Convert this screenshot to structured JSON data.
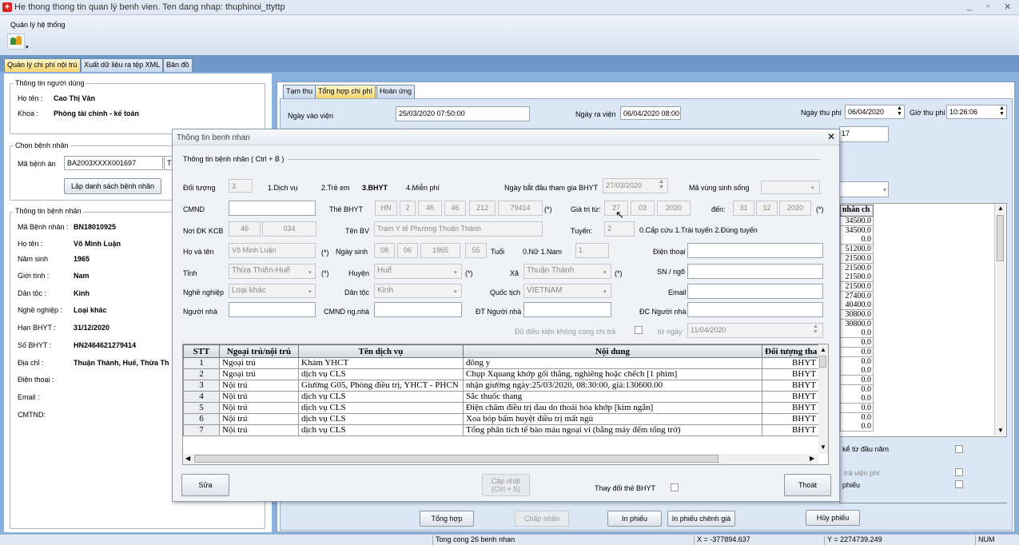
{
  "window": {
    "title": "He thong thong tin quan lý benh vien. Ten dang nhap: thuphinoi_ttyttp",
    "controls": [
      "_",
      "▫",
      "✕"
    ]
  },
  "menu": {
    "system": "Quản lý hệ thống"
  },
  "main_tabs": [
    {
      "label": "Quản lý chi phí nội trú",
      "active": true
    },
    {
      "label": "Xuất dữ liệu ra tệp XML",
      "active": false
    },
    {
      "label": "Bản đồ",
      "active": false
    }
  ],
  "user_info": {
    "group": "Thông tin người dùng",
    "name_label": "Họ tên :",
    "name": "Cao Thị Vân",
    "dept_label": "Khoa :",
    "dept": "Phòng tài chính - kế toán"
  },
  "select_patient": {
    "group": "Chọn bệnh nhân",
    "record_label": "Mã bệnh án",
    "record_value": "BA2003XXXX001697",
    "record_tail": "T",
    "list_button": "Lập danh sách bệnh nhân"
  },
  "patient_panel": {
    "group": "Thông tin bệnh nhân",
    "rows": [
      {
        "label": "Mã Bệnh nhân :",
        "value": "BN18010925"
      },
      {
        "label": "Họ tên :",
        "value": "Võ Minh Luận"
      },
      {
        "label": "Năm sinh",
        "value": "1965"
      },
      {
        "label": "Giới tính :",
        "value": "Nam"
      },
      {
        "label": "Dân tộc :",
        "value": "Kinh"
      },
      {
        "label": "Nghề nghiệp :",
        "value": "Loại khác"
      },
      {
        "label": "Hạn BHYT :",
        "value": "31/12/2020"
      },
      {
        "label": "Số BHYT :",
        "value": "HN2464621279414"
      },
      {
        "label": "Địa chỉ :",
        "value": "Thuận Thành, Huế, Thừa Th"
      },
      {
        "label": "Điện thoại :",
        "value": ""
      },
      {
        "label": "Email :",
        "value": ""
      },
      {
        "label": "CMTND:",
        "value": ""
      }
    ]
  },
  "right_tabs": [
    {
      "label": "Tạm thu",
      "active": false
    },
    {
      "label": "Tổng hợp chi phí",
      "active": true
    },
    {
      "label": "Hoàn ứng",
      "active": false
    }
  ],
  "right_fields": {
    "admit_label": "Ngày vào viện",
    "admit": "25/03/2020 07:50:00",
    "discharge_label": "Ngày ra viện",
    "discharge": "06/04/2020 08:00",
    "pay_date_label": "Ngày thu phí",
    "pay_date": "06/04/2020",
    "pay_time_label": "Giờ thu phí",
    "pay_time": "10:26:06",
    "partial": "17"
  },
  "bg_values": {
    "header": "nhân ch",
    "values": [
      "34500.0",
      "34500.0",
      "0.0",
      "51200.0",
      "21500.0",
      "21500.0",
      "21500.0",
      "21500.0",
      "27400.0",
      "40400.0",
      "30800.0",
      "30800.0",
      "0.0",
      "0.0",
      "0.0",
      "0.0",
      "0.0",
      "0.0",
      "0.0",
      "0.0",
      "0.0",
      "0.0",
      "0.0"
    ]
  },
  "bg_options": [
    {
      "label": "kể từ đầu năm"
    },
    {
      "label": "trả viện phí"
    },
    {
      "label": "phiếu"
    }
  ],
  "bottom_buttons": [
    {
      "label": "Tổng hợp",
      "disabled": false
    },
    {
      "label": "Chấp nhận",
      "disabled": true
    },
    {
      "label": "In phiếu",
      "disabled": false
    },
    {
      "label": "In phiếu chênh giá",
      "disabled": false
    },
    {
      "label": "Hủy phiếu",
      "disabled": false
    }
  ],
  "status": {
    "total": "Tong cong 26 benh nhan",
    "x": "X = -377894.637",
    "y": "Y = 2274739.249",
    "num": "NUM"
  },
  "dialog": {
    "title": "Thông tin benh nhan",
    "section": "Thông tin bệnh nhân ( Ctrl + B )",
    "object_label": "Đối tượng",
    "object_value": "3",
    "object_opts": [
      "1.Dịch vụ",
      "2.Trẻ em",
      "3.BHYT",
      "4.Miễn phí"
    ],
    "bhyt_start_label": "Ngày bắt đầu tham gia BHYT",
    "bhyt_start": "27/03/2020",
    "region_label": "Mã vùng sinh sống",
    "region": "",
    "cmnd_label": "CMND",
    "cmnd": "",
    "card_label": "Thẻ BHYT",
    "card_parts": [
      "HN",
      "2",
      "46",
      "46",
      "212",
      "79414"
    ],
    "req": "(*)",
    "valid_from_label": "Giá trị từ:",
    "valid_from": [
      "27",
      "03",
      "2020"
    ],
    "valid_to_label": "đến:",
    "valid_to": [
      "31",
      "12",
      "2020"
    ],
    "reg_label": "Nơi ĐK KCB",
    "reg_parts": [
      "46",
      "034"
    ],
    "hosp_label": "Tên BV",
    "hosp": "Trạm Y tế Phường Thuận Thành",
    "route_label": "Tuyến:",
    "route": "2",
    "route_opts": "0.Cấp cứu   1.Trái tuyến   2.Đúng tuyến",
    "name_label": "Họ và tên",
    "name": "Võ Minh Luận",
    "dob_label": "Ngày sinh",
    "dob": [
      "08",
      "06",
      "1965"
    ],
    "age": "55",
    "age_label": "Tuổi",
    "gender_opts": "0.Nữ   1.Nam",
    "gender": "1",
    "phone_label": "Điện thoại",
    "phone": "",
    "province_label": "Tỉnh",
    "province": "Thừa Thiên-Huế",
    "district_label": "Huyện",
    "district": "Huế",
    "ward_label": "Xã",
    "ward": "Thuận Thành",
    "street_label": "SN / ngõ",
    "street": "",
    "job_label": "Nghề nghiệp",
    "job": "Loại khác",
    "ethnic_label": "Dân tộc",
    "ethnic": "Kinh",
    "nation_label": "Quốc tịch",
    "nation": "VIETNAM",
    "email_label": "Email",
    "email": "",
    "relative_label": "Người nhà",
    "relative": "",
    "rel_id_label": "CMND ng.nhà",
    "rel_id": "",
    "rel_phone_label": "ĐT Người nhà",
    "rel_phone": "",
    "rel_addr_label": "ĐC Người nhà",
    "rel_addr": "",
    "cond_label": "Đủ điều kiện không cùng chi trả",
    "from_date_label": "từ ngày",
    "from_date": "11/04/2020",
    "table": {
      "headers": [
        "STT",
        "Ngoại trú/nội trú",
        "Tên dịch vụ",
        "Nội dung",
        "Đối tượng tha"
      ],
      "rows": [
        [
          "1",
          "Ngoại trú",
          "Khám YHCT",
          "đông y",
          "BHYT"
        ],
        [
          "2",
          "Ngoại trú",
          "dịch vụ CLS",
          "Chụp Xquang khớp gối thẳng, nghiêng hoặc chếch [1 phim]",
          "BHYT"
        ],
        [
          "3",
          "Nội trú",
          "Giường G05, Phòng điều trị, YHCT - PHCN",
          "nhận giường ngày:25/03/2020, 08:30:00, giá:130600.00",
          "BHYT"
        ],
        [
          "4",
          "Nội trú",
          "dịch vụ CLS",
          "Sắc thuốc thang",
          "BHYT"
        ],
        [
          "5",
          "Nội trú",
          "dịch vụ CLS",
          "Điện châm điều trị đau do thoái hóa khớp [kim ngắn]",
          "BHYT"
        ],
        [
          "6",
          "Nội trú",
          "dịch vụ CLS",
          "Xoa bóp bấm huyệt điều trị mất ngủ",
          "BHYT"
        ],
        [
          "7",
          "Nội trú",
          "dịch vụ CLS",
          "Tổng phân tích tế bào máu ngoại vi (bằng máy đếm tổng trở)",
          "BHYT"
        ]
      ]
    },
    "btn_edit": "Sửa",
    "btn_update": "Cập nhật\n(Ctrl + S)",
    "change_card_label": "Thay đổi thẻ BHYT",
    "btn_exit": "Thoát"
  }
}
